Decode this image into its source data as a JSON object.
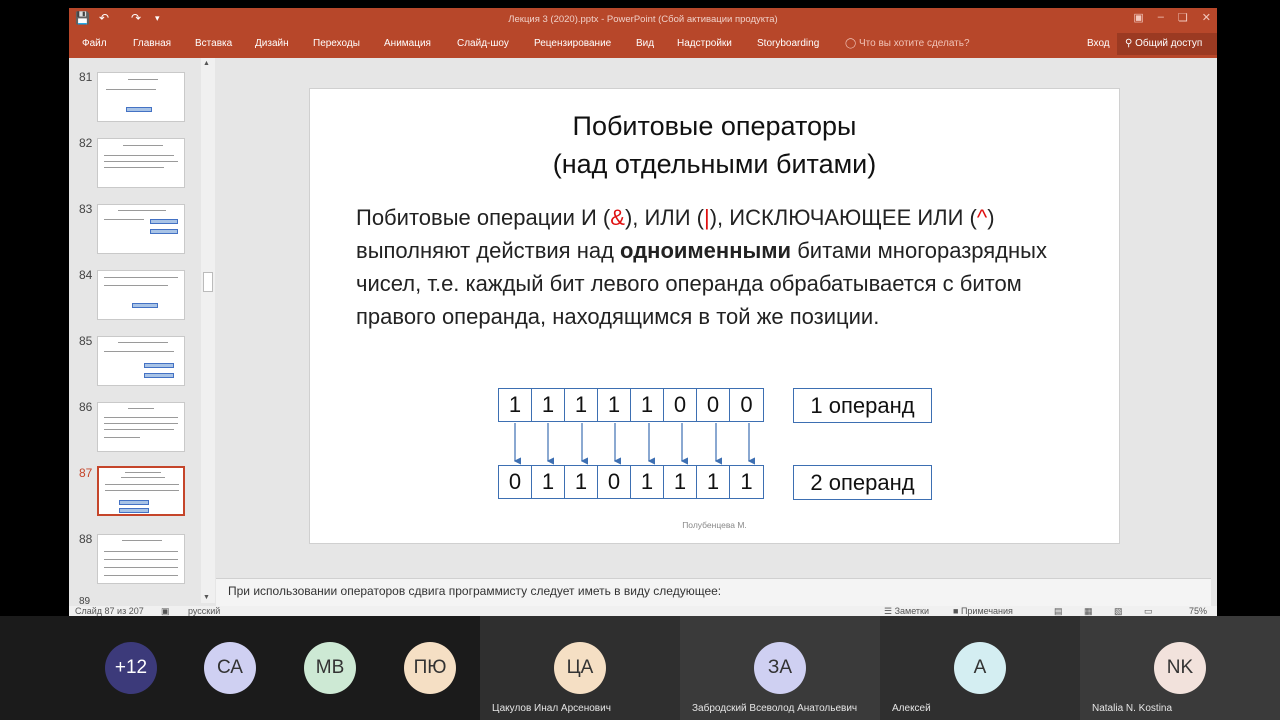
{
  "window": {
    "title": "Лекция 3 (2020).pptx - PowerPoint (Сбой активации продукта)"
  },
  "ribbon": {
    "tabs": [
      "Файл",
      "Главная",
      "Вставка",
      "Дизайн",
      "Переходы",
      "Анимация",
      "Слайд-шоу",
      "Рецензирование",
      "Вид",
      "Надстройки",
      "Storyboarding"
    ],
    "tell_me": "Что вы хотите сделать?",
    "signin": "Вход",
    "share": "Общий доступ"
  },
  "thumbnails": {
    "numbers": [
      "81",
      "82",
      "83",
      "84",
      "85",
      "86",
      "87",
      "88",
      "89"
    ],
    "active": "87"
  },
  "slide": {
    "title_line1": "Побитовые операторы",
    "title_line2": "(над отдельными битами)",
    "body_1": "Побитовые операции   И (",
    "op_and": "&",
    "body_2": "), ИЛИ (",
    "op_or": "|",
    "body_3": "), ИСКЛЮЧАЮЩЕЕ ИЛИ (",
    "op_xor": "^",
    "body_4": ") выполняют действия над ",
    "body_bold": "одноименными",
    "body_5": " битами многоразрядных чисел, т.е. каждый бит левого операнда обрабатывается с битом правого операнда, находящимся в той же позиции.",
    "operand1_bits": [
      "1",
      "1",
      "1",
      "1",
      "1",
      "0",
      "0",
      "0"
    ],
    "operand2_bits": [
      "0",
      "1",
      "1",
      "0",
      "1",
      "1",
      "1",
      "1"
    ],
    "operand1_label": "1 операнд",
    "operand2_label": "2 операнд",
    "author": "Полубенцева М."
  },
  "notes": {
    "text": "При использовании операторов сдвига программисту следует иметь в виду следующее:"
  },
  "status": {
    "slide_counter": "Слайд 87 из 207",
    "language": "русский",
    "notes_btn": "Заметки",
    "comments_btn": "Примечания",
    "zoom": "75%"
  },
  "participants": {
    "tiles": [
      {
        "initials": "+12",
        "name": "",
        "color": "#3c3a7a"
      },
      {
        "initials": "СА",
        "name": "",
        "color": "#cfd0f2"
      },
      {
        "initials": "МВ",
        "name": "",
        "color": "#cde9d4"
      },
      {
        "initials": "ПЮ",
        "name": "",
        "color": "#f5dfc4"
      },
      {
        "initials": "ЦА",
        "name": "Цакулов Инал Арсенович",
        "color": "#f5dfc4"
      },
      {
        "initials": "ЗА",
        "name": "Забродский Всеволод Анатольевич",
        "color": "#cfd0f2"
      },
      {
        "initials": "А",
        "name": "Алексей",
        "color": "#d4eef2"
      },
      {
        "initials": "NK",
        "name": "Natalia N. Kostina",
        "color": "#f2e2dc"
      }
    ]
  }
}
